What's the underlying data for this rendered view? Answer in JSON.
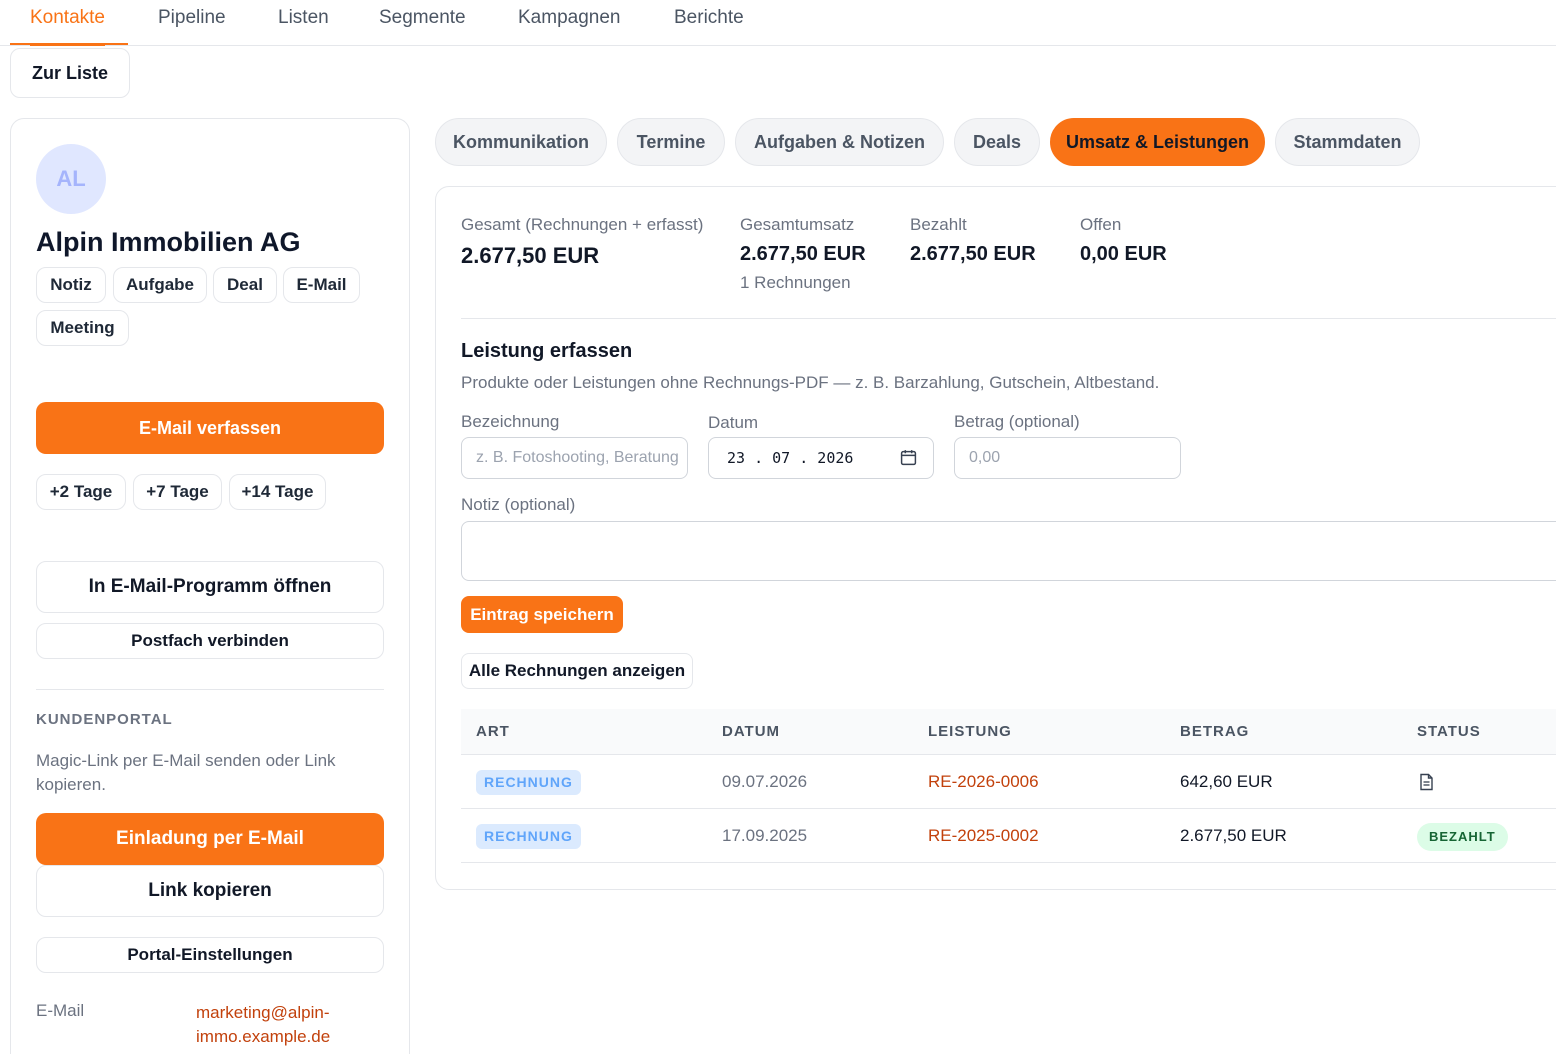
{
  "nav": {
    "tabs": [
      "Kontakte",
      "Pipeline",
      "Listen",
      "Segmente",
      "Kampagnen",
      "Berichte"
    ],
    "active": "Kontakte",
    "back_label": "Zur Liste"
  },
  "contact": {
    "initials": "AL",
    "name": "Alpin Immobilien AG",
    "quick_actions": [
      "Notiz",
      "Aufgabe",
      "Deal",
      "E-Mail",
      "Meeting"
    ],
    "compose_label": "E-Mail verfassen",
    "followups": [
      "+2 Tage",
      "+7 Tage",
      "+14 Tage"
    ],
    "open_mail_label": "In E-Mail-Programm öffnen",
    "connect_mailbox_label": "Postfach verbinden",
    "portal": {
      "title": "KUNDENPORTAL",
      "description": "Magic-Link per E-Mail senden oder Link kopieren.",
      "invite_label": "Einladung per E-Mail",
      "copy_label": "Link kopieren",
      "settings_label": "Portal-Einstellungen"
    },
    "email_label": "E-Mail",
    "email_value": "marketing@alpin-immo.example.de"
  },
  "panel_tabs": {
    "items": [
      "Kommunikation",
      "Termine",
      "Aufgaben & Notizen",
      "Deals",
      "Umsatz & Leistungen",
      "Stammdaten"
    ],
    "active": "Umsatz & Leistungen"
  },
  "stats": {
    "total_label": "Gesamt (Rechnungen + erfasst)",
    "total_value": "2.677,50 EUR",
    "revenue_label": "Gesamtumsatz",
    "revenue_value": "2.677,50 EUR",
    "revenue_sub": "1 Rechnungen",
    "paid_label": "Bezahlt",
    "paid_value": "2.677,50 EUR",
    "open_label": "Offen",
    "open_value": "0,00 EUR"
  },
  "form": {
    "title": "Leistung erfassen",
    "description": "Produkte oder Leistungen ohne Rechnungs-PDF — z. B. Barzahlung, Gutschein, Altbestand.",
    "name_label": "Bezeichnung",
    "name_placeholder": "z. B. Fotoshooting, Beratung",
    "date_label": "Datum",
    "date_value": "23 . 07 . 2026",
    "amount_label": "Betrag (optional)",
    "amount_placeholder": "0,00",
    "note_label": "Notiz (optional)",
    "save_label": "Eintrag speichern",
    "all_invoices_label": "Alle Rechnungen anzeigen"
  },
  "table": {
    "headers": [
      "ART",
      "DATUM",
      "LEISTUNG",
      "BETRAG",
      "STATUS"
    ],
    "rows": [
      {
        "type": "RECHNUNG",
        "date": "09.07.2026",
        "service": "RE-2026-0006",
        "amount": "642,60 EUR",
        "status": "",
        "status_icon": "document-icon"
      },
      {
        "type": "RECHNUNG",
        "date": "17.09.2025",
        "service": "RE-2025-0002",
        "amount": "2.677,50 EUR",
        "status": "BEZAHLT"
      }
    ]
  },
  "colors": {
    "accent": "#f97316",
    "link": "#c2410c",
    "badge_blue_bg": "#dbeafe",
    "badge_green_bg": "#dcfce7"
  }
}
